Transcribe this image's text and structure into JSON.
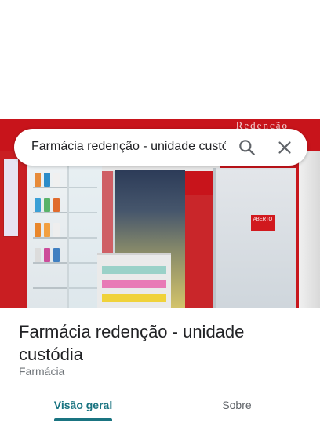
{
  "search": {
    "query": "Farmácia redenção - unidade custódia"
  },
  "photo": {
    "sign_text": "Redenção",
    "aberto_label": "ABERTO"
  },
  "place": {
    "name": "Farmácia redenção - unidade custódia",
    "category": "Farmácia"
  },
  "tabs": [
    {
      "label": "Visão geral",
      "active": true
    },
    {
      "label": "Sobre",
      "active": false
    }
  ],
  "colors": {
    "accent": "#1a7481",
    "storefront_red": "#c8141b"
  },
  "icons": {
    "search": "search-icon",
    "close": "close-icon"
  }
}
